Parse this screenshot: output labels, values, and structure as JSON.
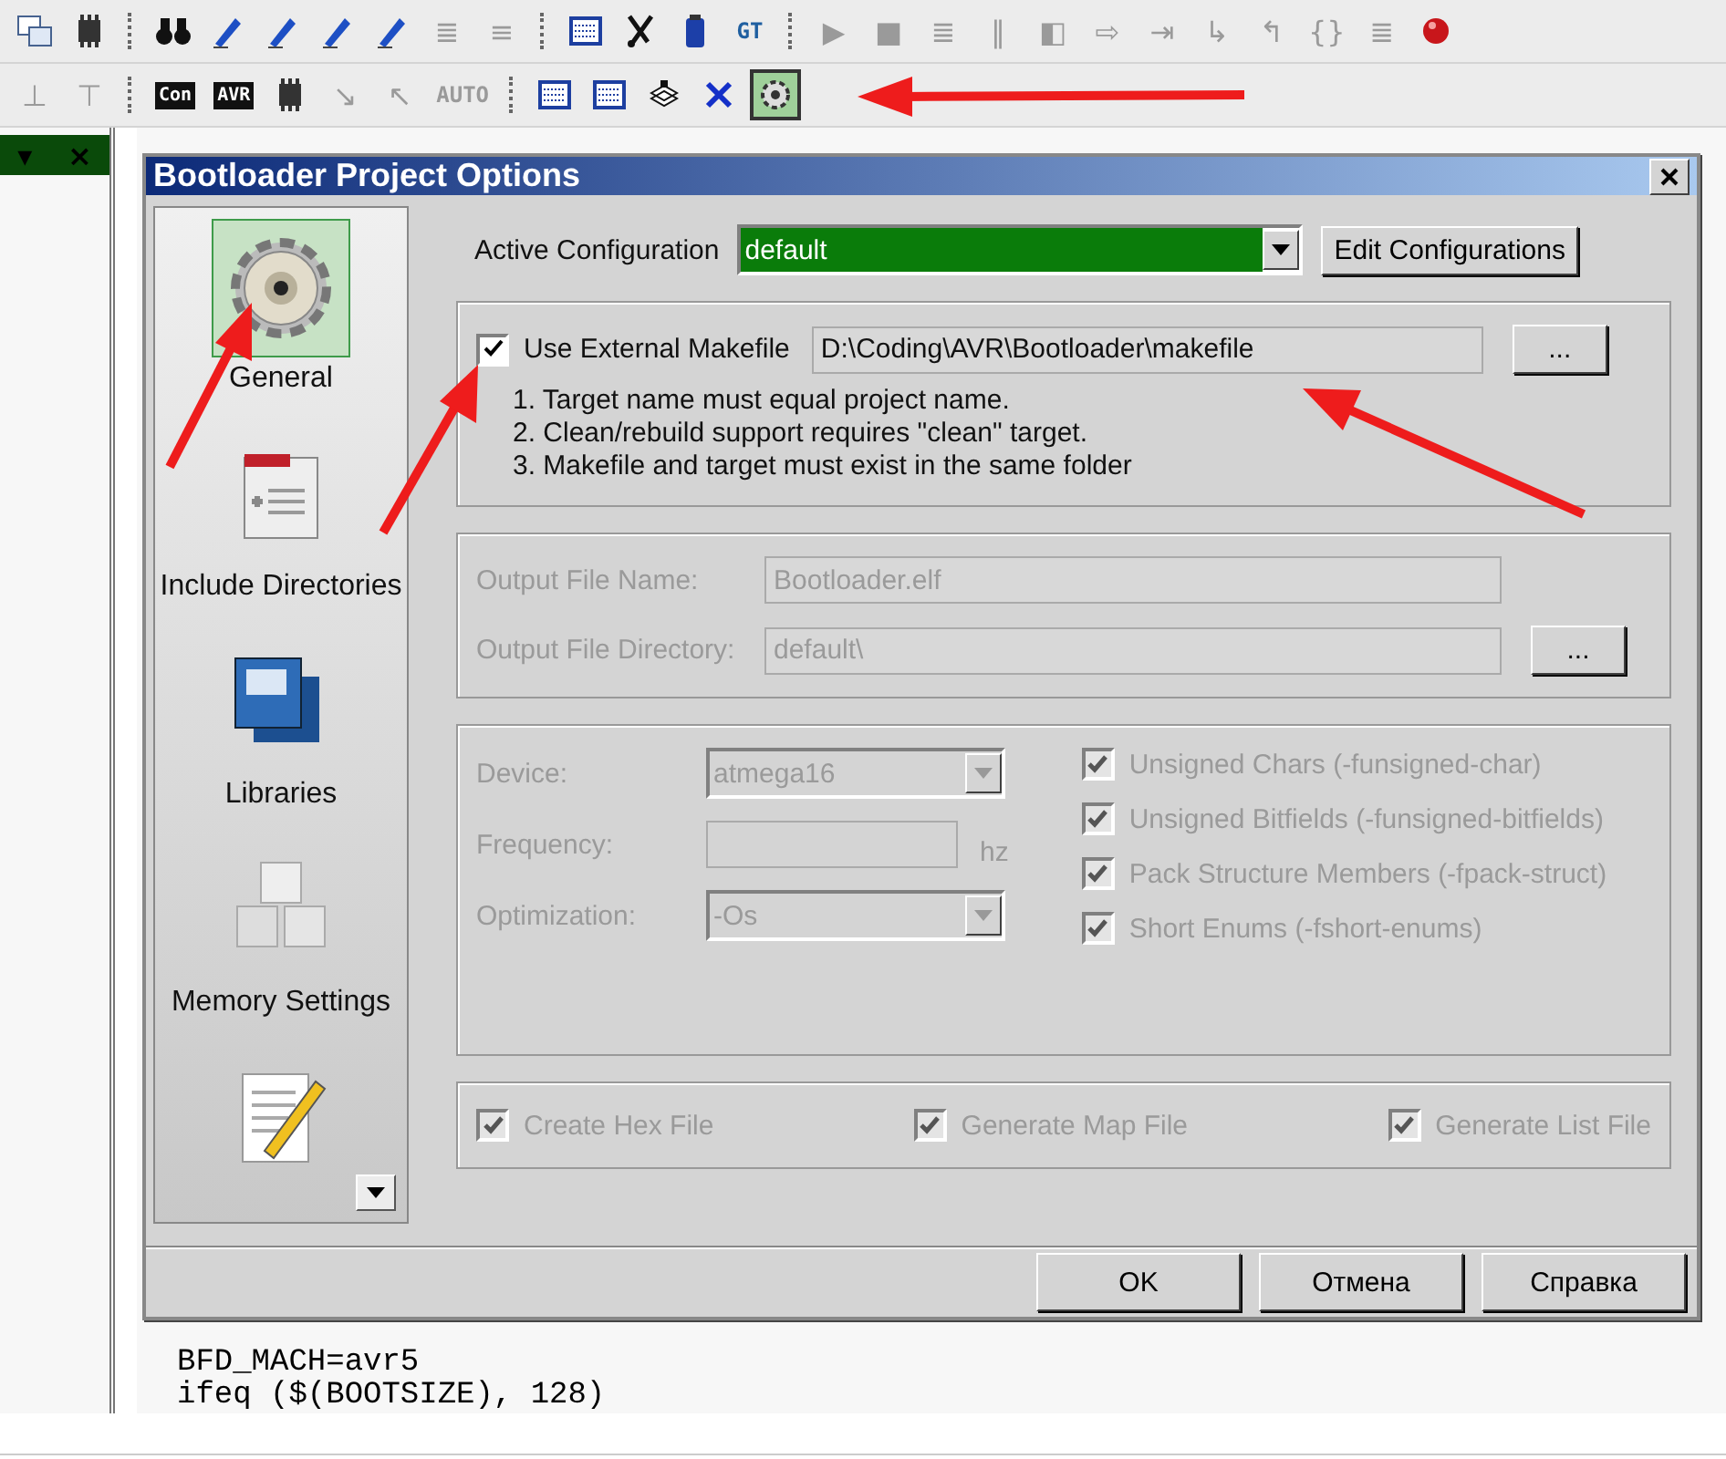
{
  "toolbar_rows": [
    {
      "items": [
        {
          "kind": "windows",
          "selected": false
        },
        {
          "kind": "chip",
          "selected": false
        },
        {
          "kind": "sep"
        },
        {
          "kind": "binoculars",
          "selected": false
        },
        {
          "kind": "pen",
          "selected": false
        },
        {
          "kind": "pen",
          "selected": false
        },
        {
          "kind": "pen",
          "selected": false
        },
        {
          "kind": "pen",
          "selected": false
        },
        {
          "kind": "glyph",
          "label": "≣",
          "selected": false
        },
        {
          "kind": "glyph",
          "label": "≡",
          "selected": false
        },
        {
          "kind": "sep"
        },
        {
          "kind": "grid",
          "selected": false
        },
        {
          "kind": "scissors",
          "selected": false
        },
        {
          "kind": "bottle",
          "selected": false
        },
        {
          "kind": "label",
          "label": "GT",
          "color": "#1f5fa0",
          "selected": false
        },
        {
          "kind": "sep"
        },
        {
          "kind": "glyph",
          "label": "▶",
          "selected": false
        },
        {
          "kind": "glyph",
          "label": "■",
          "selected": false
        },
        {
          "kind": "glyph",
          "label": "≣",
          "selected": false
        },
        {
          "kind": "glyph",
          "label": "‖",
          "selected": false
        },
        {
          "kind": "glyph",
          "label": "◧",
          "selected": false
        },
        {
          "kind": "glyph",
          "label": "⇨",
          "selected": false
        },
        {
          "kind": "glyph",
          "label": "⇥",
          "selected": false
        },
        {
          "kind": "glyph",
          "label": "↳",
          "selected": false
        },
        {
          "kind": "glyph",
          "label": "↰",
          "selected": false
        },
        {
          "kind": "glyph",
          "label": "{}",
          "selected": false
        },
        {
          "kind": "glyph",
          "label": "≣",
          "selected": false
        },
        {
          "kind": "ball",
          "selected": false
        }
      ]
    },
    {
      "items": [
        {
          "kind": "glyph",
          "label": "⊥",
          "selected": false
        },
        {
          "kind": "glyph",
          "label": "⊤",
          "selected": false
        },
        {
          "kind": "sep"
        },
        {
          "kind": "badge",
          "label": "Con",
          "selected": false
        },
        {
          "kind": "badge",
          "label": "AVR",
          "selected": false
        },
        {
          "kind": "chip",
          "selected": false
        },
        {
          "kind": "glyph",
          "label": "↘",
          "selected": false
        },
        {
          "kind": "glyph",
          "label": "↖",
          "selected": false
        },
        {
          "kind": "label",
          "label": "AUTO",
          "color": "#9a9a9a",
          "selected": false
        },
        {
          "kind": "sep"
        },
        {
          "kind": "grid",
          "selected": false
        },
        {
          "kind": "grid",
          "selected": false
        },
        {
          "kind": "disk",
          "selected": false
        },
        {
          "kind": "cross",
          "selected": false
        },
        {
          "kind": "gear",
          "selected": true
        }
      ]
    }
  ],
  "side_pane": {
    "menu": "▾",
    "close": "×"
  },
  "code_lines": [
    "BFD_MACH=avr5",
    "ifeq ($(BOOTSIZE), 128)"
  ],
  "dialog": {
    "title": "Bootloader Project Options",
    "sidebar": {
      "items": [
        {
          "label": "General",
          "selected": true
        },
        {
          "label": "Include Directories",
          "selected": false
        },
        {
          "label": "Libraries",
          "selected": false
        },
        {
          "label": "Memory Settings",
          "selected": false
        },
        {
          "selected": false
        }
      ]
    },
    "active_configuration": {
      "label": "Active Configuration",
      "value": "default",
      "button": "Edit Configurations"
    },
    "makefile": {
      "label": "Use External Makefile",
      "checked": true,
      "value": "D:\\Coding\\AVR\\Bootloader\\makefile",
      "browse": "...",
      "notes": [
        "1. Target name must equal project name.",
        "2. Clean/rebuild support requires  \"clean\" target.",
        "3. Makefile and target must exist in the same folder"
      ]
    },
    "output": {
      "disabled": true,
      "file_name_label": "Output File Name:",
      "file_name": "Bootloader.elf",
      "directory_label": "Output File Directory:",
      "directory": "default\\",
      "browse": "..."
    },
    "compiler": {
      "disabled": true,
      "device_label": "Device:",
      "device": "atmega16",
      "frequency_label": "Frequency:",
      "frequency_unit": "hz",
      "optimization_label": "Optimization:",
      "optimization": "-Os",
      "options": [
        {
          "label": "Unsigned Chars (-funsigned-char)",
          "checked": true
        },
        {
          "label": "Unsigned Bitfields (-funsigned-bitfields)",
          "checked": true
        },
        {
          "label": "Pack Structure Members (-fpack-struct)",
          "checked": true
        },
        {
          "label": "Short Enums (-fshort-enums)",
          "checked": true
        }
      ]
    },
    "outputs": {
      "disabled": true,
      "options": [
        {
          "label": "Create Hex File",
          "checked": true
        },
        {
          "label": "Generate Map File",
          "checked": true
        },
        {
          "label": "Generate List File",
          "checked": true
        }
      ]
    },
    "buttons": [
      "OK",
      "Отмена",
      "Справка"
    ]
  }
}
